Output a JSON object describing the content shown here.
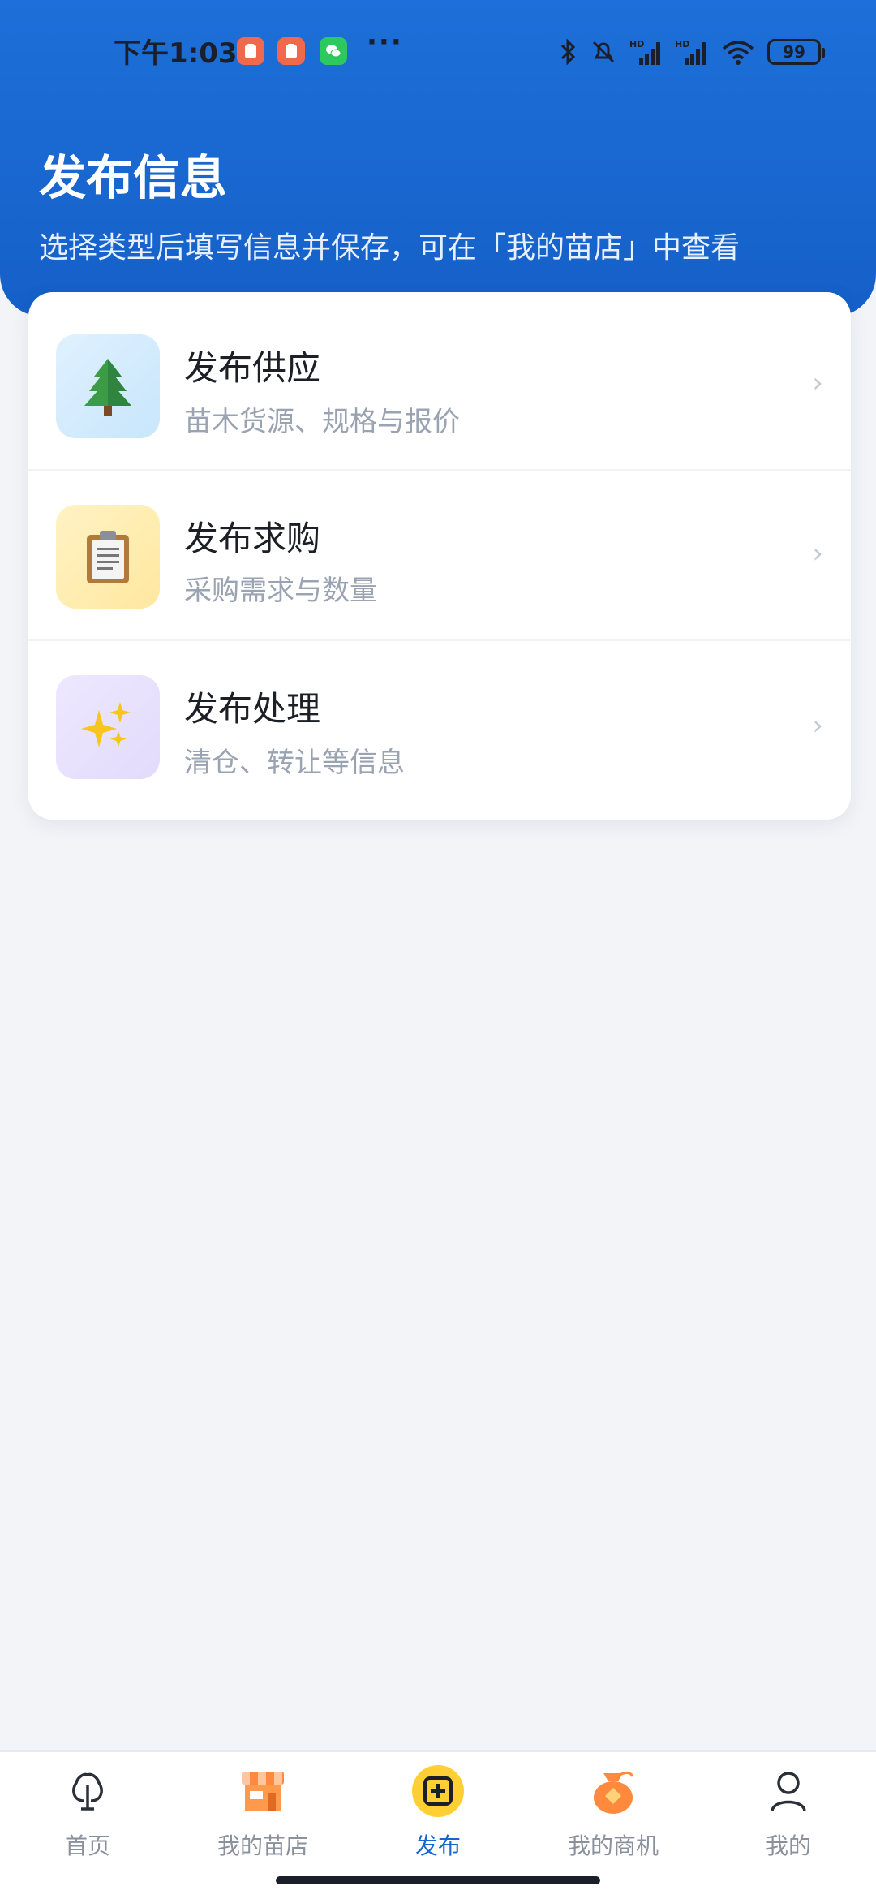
{
  "status_bar": {
    "time": "下午1:03",
    "more": "···",
    "battery": "99"
  },
  "header": {
    "title": "发布信息",
    "subtitle": "选择类型后填写信息并保存，可在「我的苗店」中查看"
  },
  "options": [
    {
      "title": "发布供应",
      "desc": "苗木货源、规格与报价",
      "icon": "evergreen-tree-icon"
    },
    {
      "title": "发布求购",
      "desc": "采购需求与数量",
      "icon": "clipboard-icon"
    },
    {
      "title": "发布处理",
      "desc": "清仓、转让等信息",
      "icon": "sparkles-icon"
    }
  ],
  "chevron": "›",
  "nav": [
    {
      "label": "首页",
      "icon": "tree-outline-icon"
    },
    {
      "label": "我的苗店",
      "icon": "shop-icon"
    },
    {
      "label": "发布",
      "icon": "plus-square-icon"
    },
    {
      "label": "我的商机",
      "icon": "money-bag-icon"
    },
    {
      "label": "我的",
      "icon": "person-icon"
    }
  ],
  "colors": {
    "header_blue": "#1e6fd9",
    "active_blue": "#1766cf",
    "publish_yellow": "#ffcf33"
  }
}
